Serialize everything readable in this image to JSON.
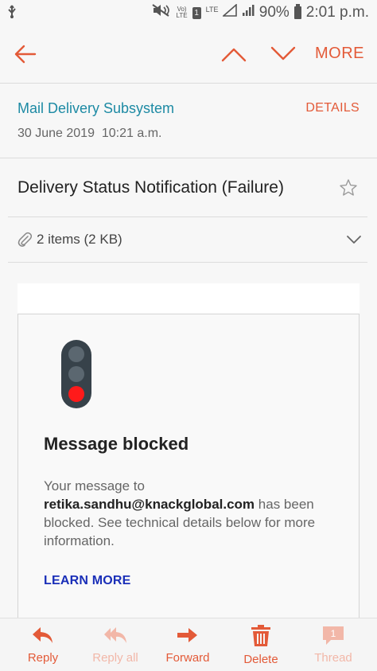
{
  "status_bar": {
    "network_badge_top": "Vo)",
    "network_badge_bottom": "LTE",
    "sim_label": "1",
    "lte_label": "LTE",
    "battery": "90%",
    "time": "2:01 p.m."
  },
  "toolbar": {
    "more_label": "MORE"
  },
  "email": {
    "sender": "Mail Delivery Subsystem",
    "details_label": "DETAILS",
    "date": "30 June 2019",
    "time": "10:21 a.m.",
    "subject": "Delivery Status Notification (Failure)",
    "attachments": "2 items (2 KB)"
  },
  "card": {
    "title": "Message blocked",
    "text_before": "Your message to",
    "recipient": "retika.sandhu@knackglobal.com",
    "text_after": "has been blocked. See technical details below for more information.",
    "learn_more": "LEARN MORE"
  },
  "bottom_bar": {
    "reply": "Reply",
    "reply_all": "Reply all",
    "forward": "Forward",
    "delete": "Delete",
    "thread": "Thread",
    "thread_count": "1"
  },
  "colors": {
    "accent": "#e35a38",
    "sender": "#1d8aa4",
    "link": "#1a2fb8",
    "red_lamp": "#ff1a1a"
  },
  "icons": [
    "usb-debug-icon",
    "mute-icon",
    "signal-icon",
    "battery-icon",
    "back-arrow-icon",
    "chevron-up-icon",
    "chevron-down-icon",
    "star-icon",
    "paperclip-icon",
    "traffic-light-icon",
    "reply-icon",
    "reply-all-icon",
    "forward-icon",
    "delete-icon",
    "thread-icon"
  ]
}
